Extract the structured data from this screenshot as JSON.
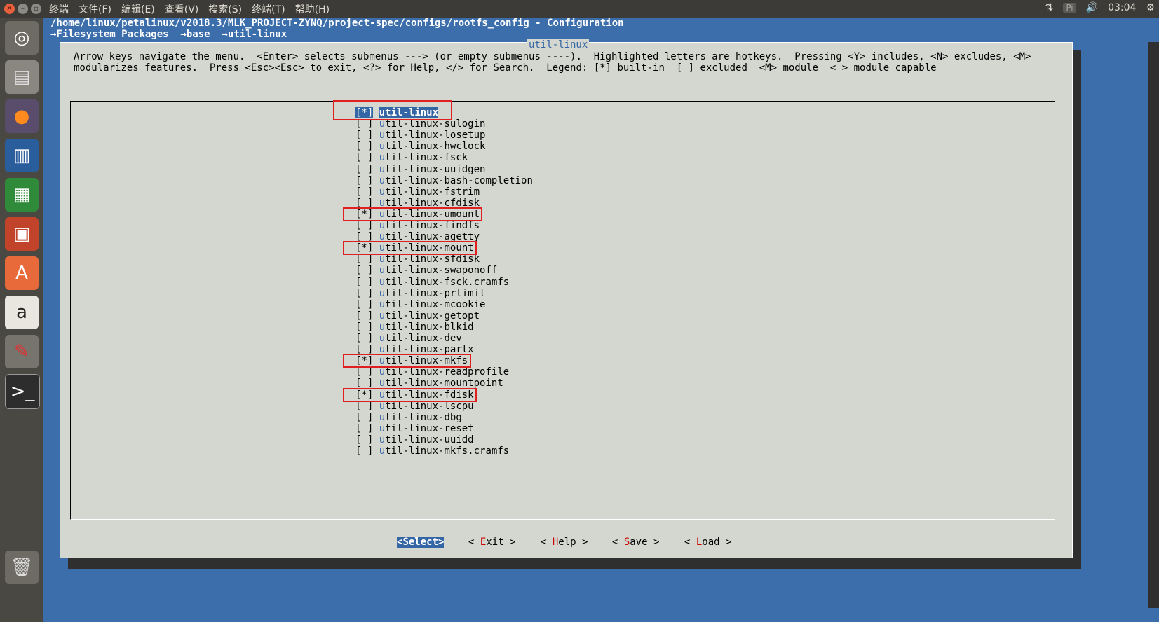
{
  "topbar": {
    "menus": [
      "终端",
      "文件(F)",
      "编辑(E)",
      "查看(V)",
      "搜索(S)",
      "终端(T)",
      "帮助(H)"
    ],
    "tray_pi": "Pi",
    "clock": "03:04"
  },
  "terminal": {
    "path": "/home/linux/petalinux/v2018.3/MLK_PROJECT-ZYNQ/project-spec/configs/rootfs_config - Configuration",
    "breadcrumb": "→Filesystem Packages  →base  →util-linux"
  },
  "dialog": {
    "title": "util-linux",
    "help_line1": "Arrow keys navigate the menu.  <Enter> selects submenus ---> (or empty submenus ----).  Highlighted letters are hotkeys.  Pressing <Y> includes, <N> excludes, <M>",
    "help_line2": "modularizes features.  Press <Esc><Esc> to exit, <?> for Help, </> for Search.  Legend: [*] built-in  [ ] excluded  <M> module  < > module capable",
    "items": [
      {
        "box": "[*]",
        "hk": "u",
        "rest": "til-linux",
        "checked": true,
        "selected": true
      },
      {
        "box": "[ ]",
        "hk": "u",
        "rest": "til-linux-sulogin",
        "checked": false
      },
      {
        "box": "[ ]",
        "hk": "u",
        "rest": "til-linux-losetup",
        "checked": false
      },
      {
        "box": "[ ]",
        "hk": "u",
        "rest": "til-linux-hwclock",
        "checked": false
      },
      {
        "box": "[ ]",
        "hk": "u",
        "rest": "til-linux-fsck",
        "checked": false
      },
      {
        "box": "[ ]",
        "hk": "u",
        "rest": "til-linux-uuidgen",
        "checked": false
      },
      {
        "box": "[ ]",
        "hk": "u",
        "rest": "til-linux-bash-completion",
        "checked": false
      },
      {
        "box": "[ ]",
        "hk": "u",
        "rest": "til-linux-fstrim",
        "checked": false
      },
      {
        "box": "[ ]",
        "hk": "u",
        "rest": "til-linux-cfdisk",
        "checked": false
      },
      {
        "box": "[*]",
        "hk": "u",
        "rest": "til-linux-umount",
        "checked": true
      },
      {
        "box": "[ ]",
        "hk": "u",
        "rest": "til-linux-findfs",
        "checked": false
      },
      {
        "box": "[ ]",
        "hk": "u",
        "rest": "til-linux-agetty",
        "checked": false
      },
      {
        "box": "[*]",
        "hk": "u",
        "rest": "til-linux-mount",
        "checked": true
      },
      {
        "box": "[ ]",
        "hk": "u",
        "rest": "til-linux-sfdisk",
        "checked": false
      },
      {
        "box": "[ ]",
        "hk": "u",
        "rest": "til-linux-swaponoff",
        "checked": false
      },
      {
        "box": "[ ]",
        "hk": "u",
        "rest": "til-linux-fsck.cramfs",
        "checked": false
      },
      {
        "box": "[ ]",
        "hk": "u",
        "rest": "til-linux-prlimit",
        "checked": false
      },
      {
        "box": "[ ]",
        "hk": "u",
        "rest": "til-linux-mcookie",
        "checked": false
      },
      {
        "box": "[ ]",
        "hk": "u",
        "rest": "til-linux-getopt",
        "checked": false
      },
      {
        "box": "[ ]",
        "hk": "u",
        "rest": "til-linux-blkid",
        "checked": false
      },
      {
        "box": "[ ]",
        "hk": "u",
        "rest": "til-linux-dev",
        "checked": false
      },
      {
        "box": "[ ]",
        "hk": "u",
        "rest": "til-linux-partx",
        "checked": false
      },
      {
        "box": "[*]",
        "hk": "u",
        "rest": "til-linux-mkfs",
        "checked": true
      },
      {
        "box": "[ ]",
        "hk": "u",
        "rest": "til-linux-readprofile",
        "checked": false
      },
      {
        "box": "[ ]",
        "hk": "u",
        "rest": "til-linux-mountpoint",
        "checked": false
      },
      {
        "box": "[*]",
        "hk": "u",
        "rest": "til-linux-fdisk",
        "checked": true
      },
      {
        "box": "[ ]",
        "hk": "u",
        "rest": "til-linux-lscpu",
        "checked": false
      },
      {
        "box": "[ ]",
        "hk": "u",
        "rest": "til-linux-dbg",
        "checked": false
      },
      {
        "box": "[ ]",
        "hk": "u",
        "rest": "til-linux-reset",
        "checked": false
      },
      {
        "box": "[ ]",
        "hk": "u",
        "rest": "til-linux-uuidd",
        "checked": false
      },
      {
        "box": "[ ]",
        "hk": "u",
        "rest": "til-linux-mkfs.cramfs",
        "checked": false
      }
    ],
    "buttons": [
      {
        "pre": "<",
        "hk": "S",
        "rest": "elect>",
        "selected": true
      },
      {
        "pre": "< ",
        "hk": "E",
        "rest": "xit >"
      },
      {
        "pre": "< ",
        "hk": "H",
        "rest": "elp >"
      },
      {
        "pre": "< ",
        "hk": "S",
        "rest": "ave >"
      },
      {
        "pre": "< ",
        "hk": "L",
        "rest": "oad >"
      }
    ]
  },
  "annotation_color": "#e02020",
  "colors": {
    "terminal_bg": "#3c6eac",
    "dialog_bg": "#d3d7cf",
    "highlight": "#3465a4"
  }
}
